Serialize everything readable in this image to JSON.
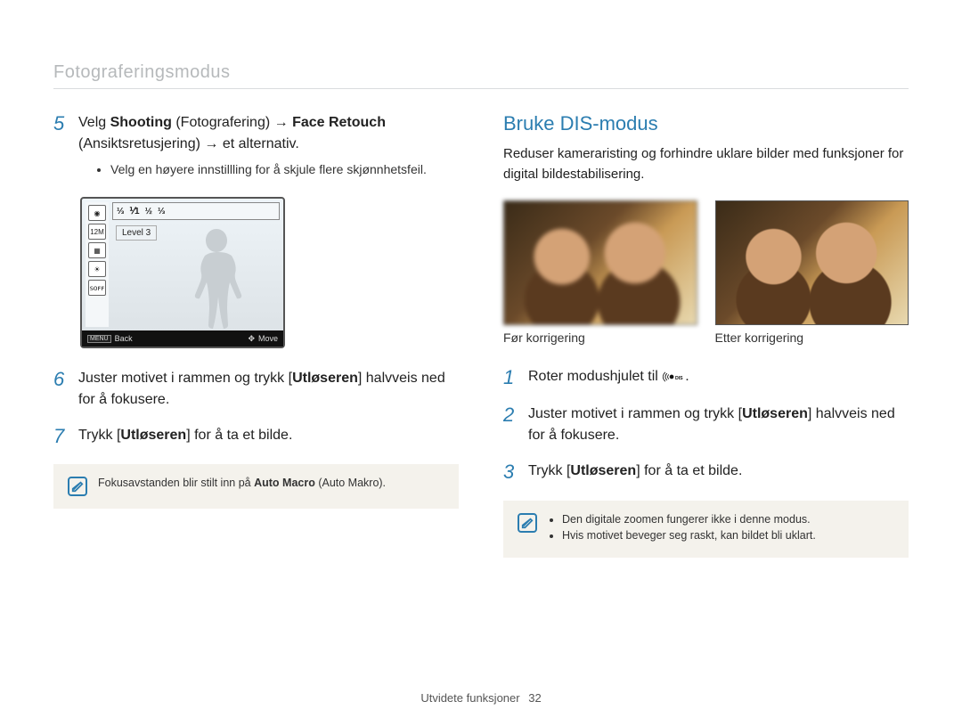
{
  "header": "Fotograferingsmodus",
  "left": {
    "steps": {
      "5": {
        "line1_prefix": "Velg ",
        "line1_b1": "Shooting",
        "line1_paren1": " (Fotografering) → ",
        "line1_b2": "Face Retouch",
        "line2": " (Ansiktsretusjering) → et alternativ.",
        "bullet": "Velg en høyere innstillling for å skjule flere skjønnhetsfeil."
      },
      "6": {
        "text_before": "Juster motivet i rammen og trykk ",
        "btn": "Utløseren",
        "text_after": " halvveis ned for å fokusere."
      },
      "7": {
        "text_before": "Trykk ",
        "btn": "Utløseren",
        "text_after": " for å ta et bilde."
      }
    },
    "lcd": {
      "topicons": [
        "⅓",
        "⅟1",
        "½",
        "⅓"
      ],
      "lefticons": [
        "◉",
        "12M",
        "▦",
        "☀",
        "ꜱᴏꜰꜰ"
      ],
      "level_label": "Level 3",
      "back_icon": "MENU",
      "back_label": "Back",
      "move_icon": "✥",
      "move_label": "Move"
    },
    "note": {
      "text_before": "Fokusavstanden blir stilt inn på ",
      "bold": "Auto Macro",
      "paren": " (Auto Makro)."
    }
  },
  "right": {
    "title": "Bruke DIS-modus",
    "intro": "Reduser kameraristing og forhindre uklare bilder med funksjoner for digital bildestabilisering.",
    "cap_before": "Før korrigering",
    "cap_after": "Etter korrigering",
    "steps": {
      "1": {
        "text_before": "Roter modushjulet til ",
        "icon_label": "DIS"
      },
      "2": {
        "text_before": "Juster motivet i rammen og trykk ",
        "btn": "Utløseren",
        "text_after": " halvveis ned for å fokusere."
      },
      "3": {
        "text_before": "Trykk ",
        "btn": "Utløseren",
        "text_after": " for å ta et bilde."
      }
    },
    "note_items": [
      "Den digitale zoomen fungerer ikke i denne modus.",
      "Hvis motivet beveger seg raskt, kan bildet bli uklart."
    ]
  },
  "footer": {
    "text": "Utvidete funksjoner",
    "page": "32"
  }
}
